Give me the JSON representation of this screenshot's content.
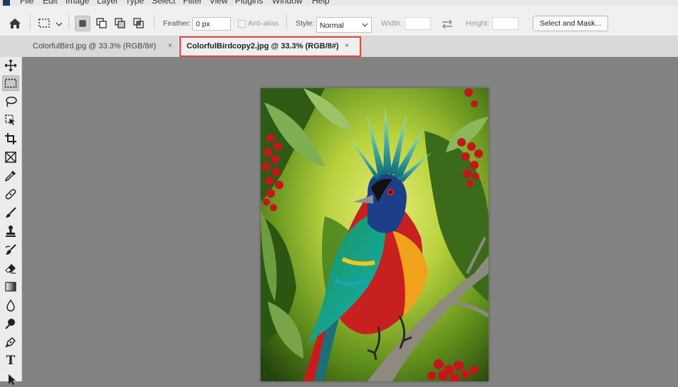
{
  "menu": {
    "items": [
      "File",
      "Edit",
      "Image",
      "Layer",
      "Type",
      "Select",
      "Filter",
      "View",
      "Plugins",
      "Window",
      "Help"
    ]
  },
  "options": {
    "feather_label": "Feather:",
    "feather_value": "0 px",
    "antialias_label": "Anti-alias",
    "style_label": "Style:",
    "style_value": "Normal",
    "width_label": "Width:",
    "height_label": "Height:",
    "select_mask_label": "Select and Mask..."
  },
  "tabs": [
    {
      "title": "ColorfulBird.jpg @ 33.3% (RGB/8#)",
      "active": false
    },
    {
      "title": "ColorfulBirdcopy2.jpg @ 33.3% (RGB/8#)",
      "active": true
    }
  ],
  "tab_close_glyph": "×",
  "tools": [
    "move-icon",
    "rect-marquee-icon",
    "lasso-icon",
    "object-select-icon",
    "crop-icon",
    "frame-icon",
    "eyedropper-icon",
    "healing-brush-icon",
    "brush-icon",
    "stamp-icon",
    "history-brush-icon",
    "eraser-icon",
    "gradient-icon",
    "blur-icon",
    "dodge-icon",
    "pen-icon",
    "type-icon",
    "path-select-icon"
  ],
  "type_tool_glyph": "T",
  "colors": {
    "accent_highlight": "#e24a3b",
    "canvas_bg": "#838383",
    "options_bg": "#f0f0f0"
  }
}
